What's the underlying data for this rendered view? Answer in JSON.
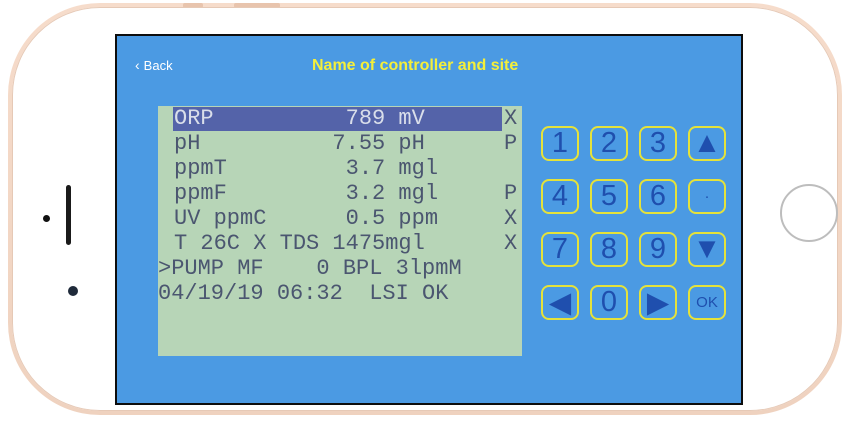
{
  "nav": {
    "back_label": "Back",
    "title": "Name of controller and site"
  },
  "lcd": {
    "rows": [
      {
        "text": "ORP          789 mV",
        "flag": "X",
        "selected": true
      },
      {
        "text": "pH          7.55 pH",
        "flag": "P"
      },
      {
        "text": "ppmT         3.7 mgl",
        "flag": ""
      },
      {
        "text": "ppmF         3.2 mgl",
        "flag": "P"
      },
      {
        "text": "UV ppmC      0.5 ppm",
        "flag": "X"
      },
      {
        "text": "T 26C X TDS 1475mgl",
        "flag": "X"
      },
      {
        "text": ">PUMP MF    0 BPL 3lpmM",
        "flag": ""
      },
      {
        "text": "04/19/19 06:32  LSI OK",
        "flag": ""
      }
    ]
  },
  "keypad": {
    "keys": [
      "1",
      "2",
      "3",
      "▲",
      "4",
      "5",
      "6",
      "·",
      "7",
      "8",
      "9",
      "▼",
      "◀",
      "0",
      "▶",
      "OK"
    ]
  },
  "colors": {
    "screen_bg": "#4b9ae3",
    "title": "#f4ef3a",
    "lcd_bg": "#b7d5b7",
    "lcd_text": "#4b5670",
    "lcd_highlight": "#5463a9",
    "key_border": "#e5e23a",
    "key_text": "#1f4fae"
  }
}
